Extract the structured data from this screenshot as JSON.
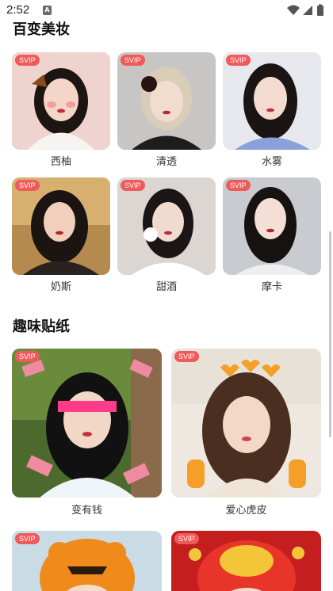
{
  "status_bar": {
    "time": "2:52",
    "app_icon": "A"
  },
  "makeup": {
    "title": "百变美妆",
    "items": [
      {
        "label": "西柚",
        "badge": "SVIP"
      },
      {
        "label": "清透",
        "badge": "SVIP"
      },
      {
        "label": "水雾",
        "badge": "SVIP"
      },
      {
        "label": "奶斯",
        "badge": "SVIP"
      },
      {
        "label": "甜酒",
        "badge": "SVIP"
      },
      {
        "label": "摩卡",
        "badge": "SVIP"
      }
    ]
  },
  "stickers": {
    "title": "趣味贴纸",
    "items": [
      {
        "label": "变有钱",
        "badge": "SVIP"
      },
      {
        "label": "爱心虎皮",
        "badge": "SVIP"
      },
      {
        "label": "",
        "badge": "SVIP"
      },
      {
        "label": "",
        "badge": "SVIP"
      }
    ]
  },
  "colors": {
    "badge": "#ef5a5a",
    "accent": "#111111"
  }
}
